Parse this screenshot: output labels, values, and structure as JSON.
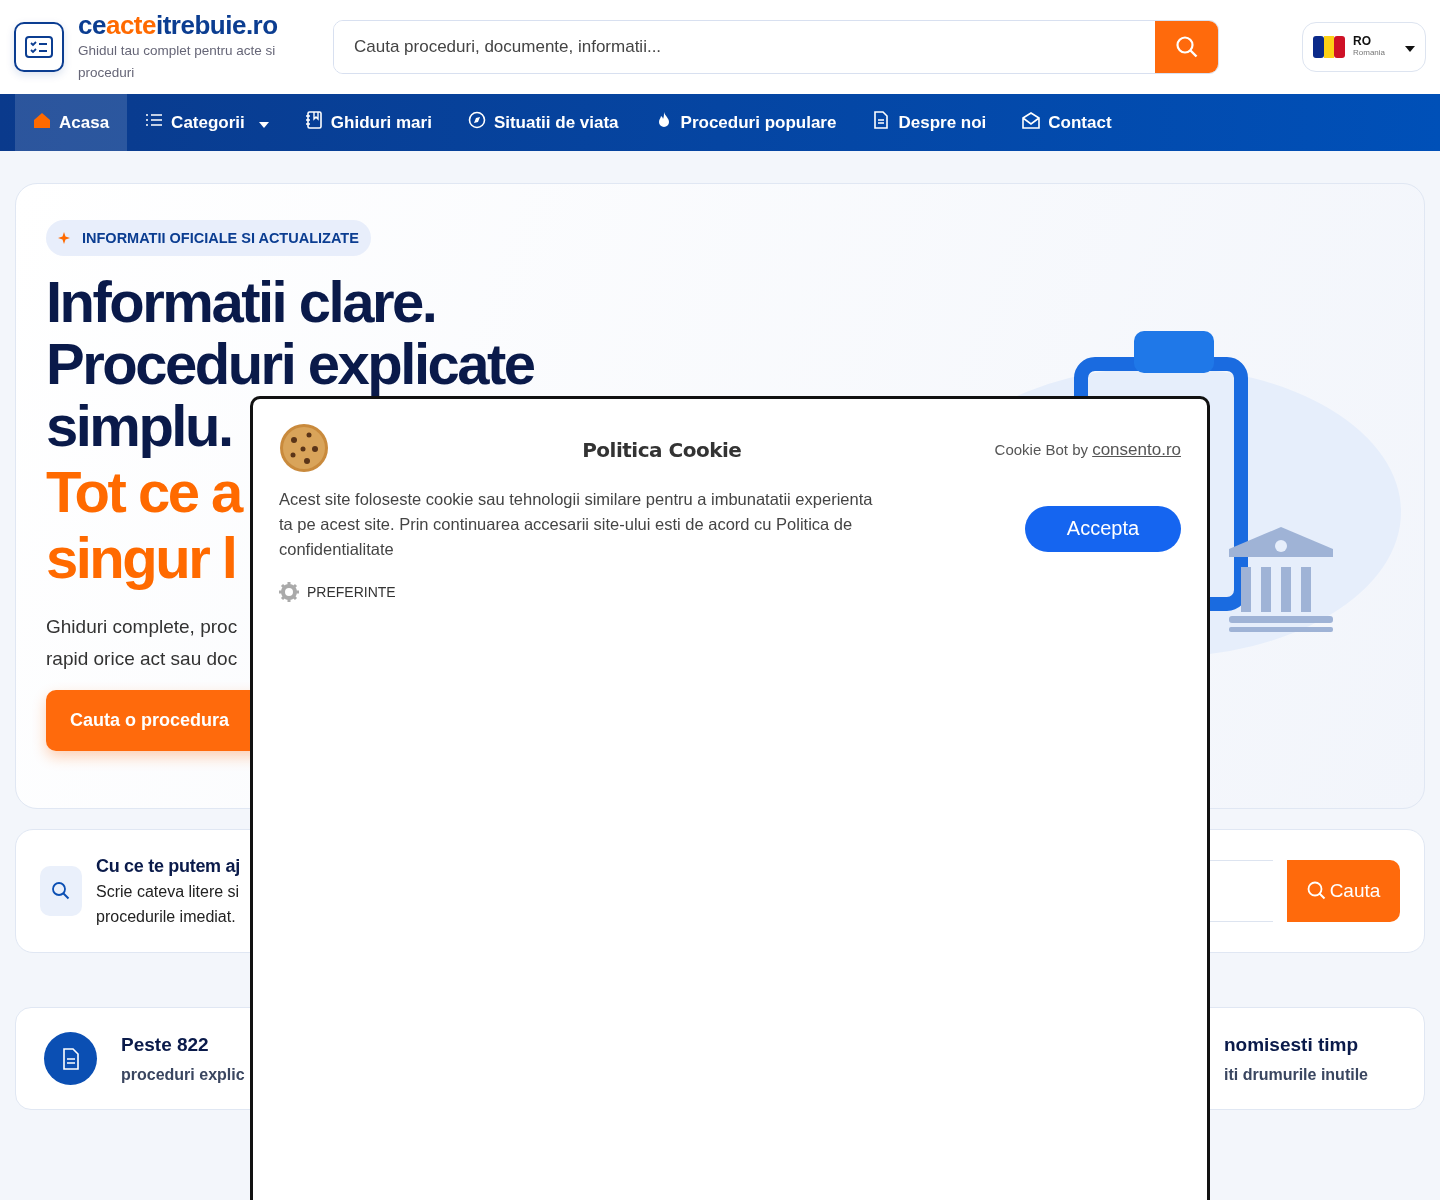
{
  "header": {
    "logo_parts": [
      {
        "text": "ce",
        "color": "#0b3d91"
      },
      {
        "text": "acte",
        "color": "#ff6a00"
      },
      {
        "text": "itrebuie.ro",
        "color": "#0b3d91"
      }
    ],
    "tagline": "Ghidul tau complet pentru acte si proceduri",
    "search": {
      "placeholder": "Cauta proceduri, documente, informatii..."
    },
    "language": {
      "code": "RO",
      "name": "Romania"
    }
  },
  "nav": [
    {
      "label": "Acasa",
      "selected": true,
      "dropdown": false
    },
    {
      "label": "Categorii",
      "selected": false,
      "dropdown": true
    },
    {
      "label": "Ghiduri mari",
      "selected": false,
      "dropdown": false
    },
    {
      "label": "Situatii de viata",
      "selected": false,
      "dropdown": false
    },
    {
      "label": "Proceduri populare",
      "selected": false,
      "dropdown": false
    },
    {
      "label": "Despre noi",
      "selected": false,
      "dropdown": false
    },
    {
      "label": "Contact",
      "selected": false,
      "dropdown": false
    }
  ],
  "hero": {
    "badge": "INFORMATII OFICIALE SI ACTUALIZATE",
    "title_lines": [
      "Informatii clare.",
      "Proceduri explicate",
      "simplu."
    ],
    "accent_lines": [
      "Tot ce a",
      "singur l"
    ],
    "subtitle_lines": [
      "Ghiduri complete, proc",
      "rapid orice act sau doc"
    ],
    "cta": "Cauta o procedura"
  },
  "help": {
    "title": "Cu ce te putem aj",
    "text_lines": [
      "Scrie cateva litere si",
      "procedurile imediat."
    ],
    "button": "Cauta"
  },
  "stats": [
    {
      "title": "Peste 822",
      "text": "proceduri explic"
    },
    {
      "title": "nomisesti timp",
      "text": "iti drumurile inutile"
    }
  ],
  "cookie": {
    "title": "Politica Cookie",
    "credit": "Cookie Bot by",
    "credit_link": "consento.ro",
    "text": "Acest site foloseste cookie sau tehnologii similare pentru a imbunatatii experienta ta pe acest site. Prin continuarea accesarii site-ului esti de acord cu Politica de confidentialitate",
    "accept": "Accepta",
    "preferences": "PREFERINTE"
  }
}
